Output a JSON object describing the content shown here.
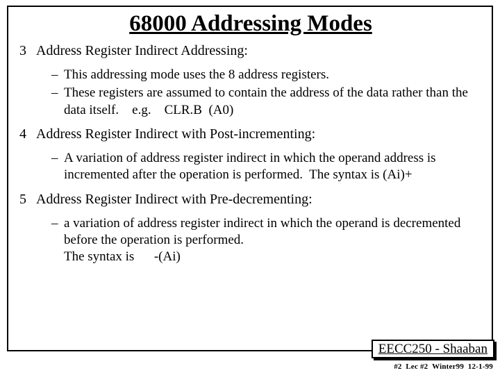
{
  "title": "68000 Addressing Modes",
  "items": {
    "i3": {
      "num": "3",
      "label": "Address Register Indirect Addressing:",
      "subs": {
        "a": "This addressing mode uses the 8 address registers.",
        "b": "These registers are assumed to contain the address of the data rather than the data itself. e.g. CLR.B  (A0)"
      }
    },
    "i4": {
      "num": "4",
      "label": "Address Register Indirect with Post-incrementing:",
      "subs": {
        "a": "A variation of address register indirect in which the operand address is incremented after the operation is performed.  The syntax is (Ai)+"
      }
    },
    "i5": {
      "num": "5",
      "label": "Address Register Indirect with Pre-decrementing:",
      "subs": {
        "a": "a variation of address register indirect in which the operand is decremented before the operation is performed.\nThe syntax is  -(Ai)"
      }
    }
  },
  "footer": {
    "course": "EECC250 - Shaaban",
    "meta": "#2 Lec #2 Winter99 12-1-99"
  }
}
